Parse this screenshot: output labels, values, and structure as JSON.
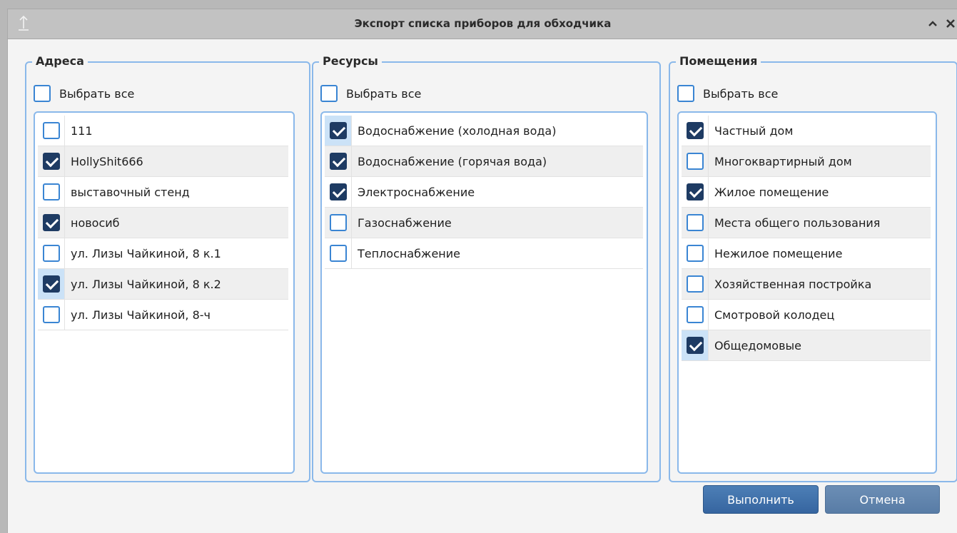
{
  "window": {
    "title": "Экспорт списка приборов для обходчика"
  },
  "groups": {
    "addresses": {
      "title": "Адреса",
      "select_all_label": "Выбрать все",
      "select_all_checked": false,
      "items": [
        {
          "label": "111",
          "checked": false
        },
        {
          "label": "HollyShit666",
          "checked": true
        },
        {
          "label": "выставочный стенд",
          "checked": false
        },
        {
          "label": "новосиб",
          "checked": true
        },
        {
          "label": "ул. Лизы Чайкиной, 8 к.1",
          "checked": false
        },
        {
          "label": "ул. Лизы Чайкиной, 8 к.2",
          "checked": true,
          "highlighted": true
        },
        {
          "label": "ул. Лизы Чайкиной, 8-ч",
          "checked": false
        }
      ]
    },
    "resources": {
      "title": "Ресурсы",
      "select_all_label": "Выбрать все",
      "select_all_checked": false,
      "items": [
        {
          "label": "Водоснабжение (холодная вода)",
          "checked": true,
          "highlighted": true
        },
        {
          "label": "Водоснабжение (горячая вода)",
          "checked": true
        },
        {
          "label": "Электроснабжение",
          "checked": true
        },
        {
          "label": "Газоснабжение",
          "checked": false
        },
        {
          "label": "Теплоснабжение",
          "checked": false
        }
      ]
    },
    "premises": {
      "title": "Помещения",
      "select_all_label": "Выбрать все",
      "select_all_checked": false,
      "items": [
        {
          "label": "Частный дом",
          "checked": true
        },
        {
          "label": "Многоквартирный дом",
          "checked": false
        },
        {
          "label": "Жилое помещение",
          "checked": true
        },
        {
          "label": "Места общего пользования",
          "checked": false
        },
        {
          "label": "Нежилое помещение",
          "checked": false
        },
        {
          "label": "Хозяйственная постройка",
          "checked": false
        },
        {
          "label": "Смотровой колодец",
          "checked": false
        },
        {
          "label": "Общедомовые",
          "checked": true,
          "highlighted": true
        }
      ]
    }
  },
  "buttons": {
    "execute_label": "Выполнить",
    "cancel_label": "Отмена"
  },
  "icons": {
    "app": "upload-arrow-icon",
    "collapse": "chevron-up-icon",
    "close": "close-icon"
  },
  "colors": {
    "accent": "#3a85d3",
    "checked": "#1e3b63",
    "group_border": "#8ab8ea",
    "button": "#3f6ea8"
  }
}
